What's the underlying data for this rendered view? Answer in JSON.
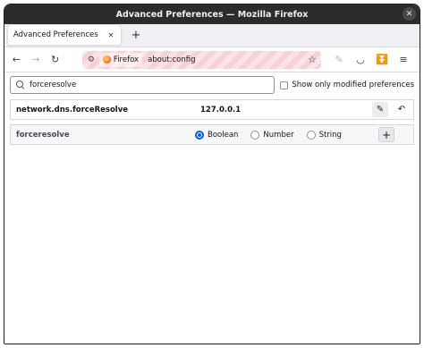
{
  "window": {
    "title": "Advanced Preferences — Mozilla Firefox",
    "close_glyph": "✕"
  },
  "tabs": [
    {
      "label": "Advanced Preferences",
      "close_glyph": "✕"
    }
  ],
  "new_tab_glyph": "+",
  "nav": {
    "back_glyph": "←",
    "forward_glyph": "→",
    "reload_glyph": "↻",
    "identity_label": "Firefox",
    "url": "about:config",
    "bookmark_glyph": "☆",
    "robot_glyph": "⚙",
    "extensions": {
      "ext1_glyph": "✎",
      "pocket_glyph": "◡",
      "download_glyph": "⏬",
      "menu_glyph": "≡"
    }
  },
  "search": {
    "value": "forceresolve",
    "show_modified_label": "Show only modified preferences"
  },
  "preferences": [
    {
      "name": "network.dns.forceResolve",
      "value": "127.0.0.1",
      "edit_glyph": "✎",
      "reset_glyph": "↶"
    }
  ],
  "new_pref": {
    "name": "forceresolve",
    "types": [
      "Boolean",
      "Number",
      "String"
    ],
    "selected_type": "Boolean",
    "add_glyph": "+"
  },
  "colors": {
    "accent": "#0060df",
    "titlebar": "#2c2c2c",
    "urlbar_stripe": "#f7d1d6"
  }
}
